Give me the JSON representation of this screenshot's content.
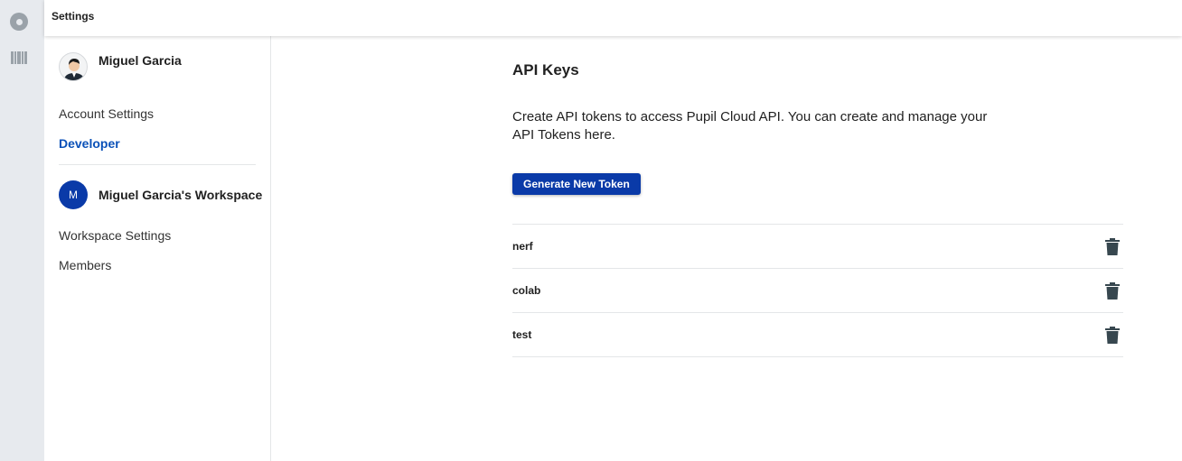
{
  "header": {
    "title": "Settings"
  },
  "rail": {
    "items": [
      {
        "icon": "record-icon"
      },
      {
        "icon": "library-icon"
      }
    ]
  },
  "sidebar": {
    "user_name": "Miguel Garcia",
    "account_items": [
      {
        "label": "Account Settings",
        "active": false
      },
      {
        "label": "Developer",
        "active": true
      }
    ],
    "workspace": {
      "avatar_letter": "M",
      "name": "Miguel Garcia's Workspace"
    },
    "workspace_items": [
      {
        "label": "Workspace Settings"
      },
      {
        "label": "Members"
      }
    ]
  },
  "main": {
    "title": "API Keys",
    "description": "Create API tokens to access Pupil Cloud API. You can create and manage your API Tokens here.",
    "generate_button": "Generate New Token",
    "tokens": [
      {
        "name": "nerf"
      },
      {
        "name": "colab"
      },
      {
        "name": "test"
      }
    ]
  },
  "colors": {
    "accent": "#0a3aa8",
    "active_link": "#0b51b8",
    "rail_bg": "#e7eaee"
  }
}
